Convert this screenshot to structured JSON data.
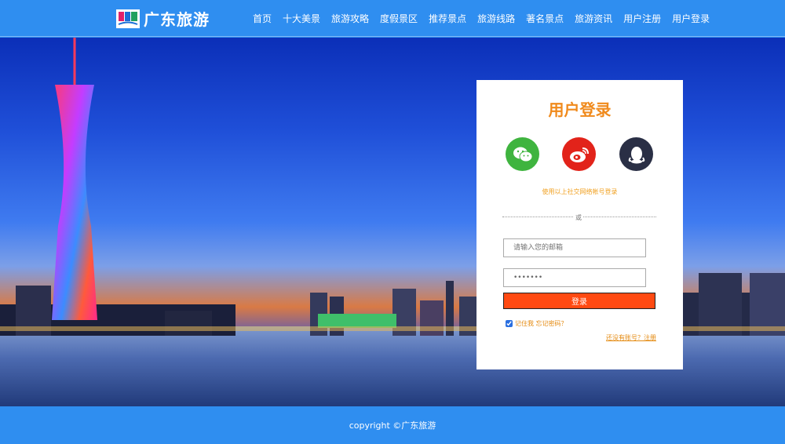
{
  "header": {
    "logo_text": "广东旅游",
    "nav": [
      "首页",
      "十大美景",
      "旅游攻略",
      "度假景区",
      "推荐景点",
      "旅游线路",
      "著名景点",
      "旅游资讯",
      "用户注册",
      "用户登录"
    ]
  },
  "login": {
    "title": "用户登录",
    "social_icons": [
      "wechat-icon",
      "weibo-icon",
      "qq-icon"
    ],
    "social_hint": "使用以上社交网络帐号登录",
    "divider_text": "或",
    "email_placeholder": "请输入您的邮箱",
    "password_value": "•••••••",
    "submit_label": "登录",
    "remember_label": "记住我 忘记密码？",
    "register_label": "还没有账号？注册"
  },
  "footer": {
    "copyright": "copyright ©广东旅游"
  },
  "colors": {
    "brand_blue": "#2f8ef0",
    "accent_orange": "#f08a1c",
    "button_red": "#ff4a12"
  }
}
